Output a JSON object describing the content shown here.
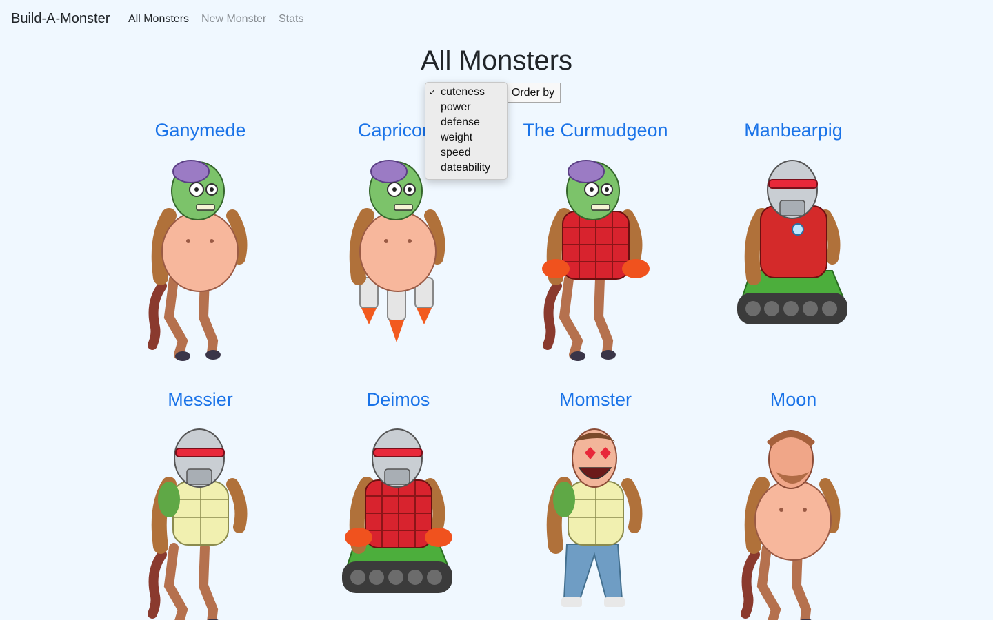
{
  "nav": {
    "brand": "Build-A-Monster",
    "links": [
      "All Monsters",
      "New Monster",
      "Stats"
    ]
  },
  "page": {
    "title": "All Monsters"
  },
  "sort": {
    "button_label": "Order by",
    "options": [
      "cuteness",
      "power",
      "defense",
      "weight",
      "speed",
      "dateability"
    ],
    "selected": "cuteness",
    "check_glyph": "✓"
  },
  "monsters": [
    {
      "name": "Ganymede",
      "head": "zombie",
      "torso": "belly",
      "legs": "horse"
    },
    {
      "name": "Capricorn",
      "head": "zombie",
      "torso": "belly",
      "legs": "jetpack"
    },
    {
      "name": "The Curmudgeon",
      "head": "zombie",
      "torso": "flannel",
      "legs": "horse"
    },
    {
      "name": "Manbearpig",
      "head": "robot",
      "torso": "armor",
      "legs": "tank"
    },
    {
      "name": "Messier",
      "head": "robot",
      "torso": "shell",
      "legs": "horse"
    },
    {
      "name": "Deimos",
      "head": "robot",
      "torso": "flannel",
      "legs": "tank"
    },
    {
      "name": "Momster",
      "head": "lover",
      "torso": "shell",
      "legs": "jeans"
    },
    {
      "name": "Moon",
      "head": "bearded",
      "torso": "belly",
      "legs": "horse"
    }
  ],
  "colors": {
    "background": "#f0f8ff",
    "link": "#1a73e8",
    "zombie_skin": "#7cc36a",
    "brain": "#9b7bc4",
    "robot_metal": "#c9ced3",
    "visor": "#e8283a",
    "belly_skin": "#f7b79c",
    "arm_fur": "#b0713a",
    "horse_leg": "#b5714e",
    "tail": "#8a3a2e",
    "flannel": "#d8232e",
    "armor": "#d42a2a",
    "shell": "#f1f0b0",
    "tank": "#4cae3c",
    "jeans": "#6f9dc4",
    "flame": "#f25a1e"
  }
}
